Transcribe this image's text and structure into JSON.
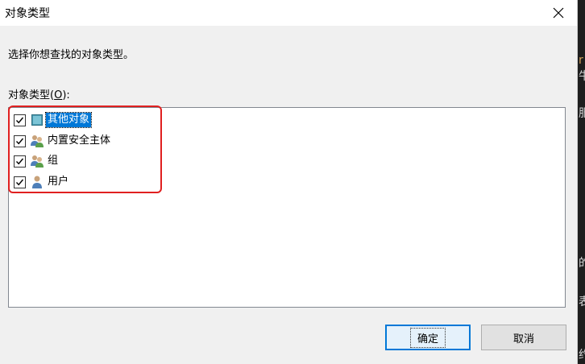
{
  "dialog": {
    "title": "对象类型",
    "instruction": "选择你想查找的对象类型。",
    "list_label_prefix": "对象类型(",
    "list_label_access": "O",
    "list_label_suffix": "):",
    "items": [
      {
        "label": "其他对象",
        "checked": true,
        "selected": true,
        "icon": "object-icon"
      },
      {
        "label": "内置安全主体",
        "checked": true,
        "selected": false,
        "icon": "group-icon"
      },
      {
        "label": "组",
        "checked": true,
        "selected": false,
        "icon": "group-icon"
      },
      {
        "label": "用户",
        "checked": true,
        "selected": false,
        "icon": "user-icon"
      }
    ],
    "ok_label": "确定",
    "cancel_label": "取消"
  },
  "background_editor_fragments": [
    "r",
    "牛",
    "",
    "服",
    "",
    "",
    "的",
    "",
    "表",
    "",
    "约"
  ],
  "colors": {
    "selection": "#0078d7",
    "annotation_box": "#e02020",
    "dialog_bg": "#f0f0f0"
  }
}
